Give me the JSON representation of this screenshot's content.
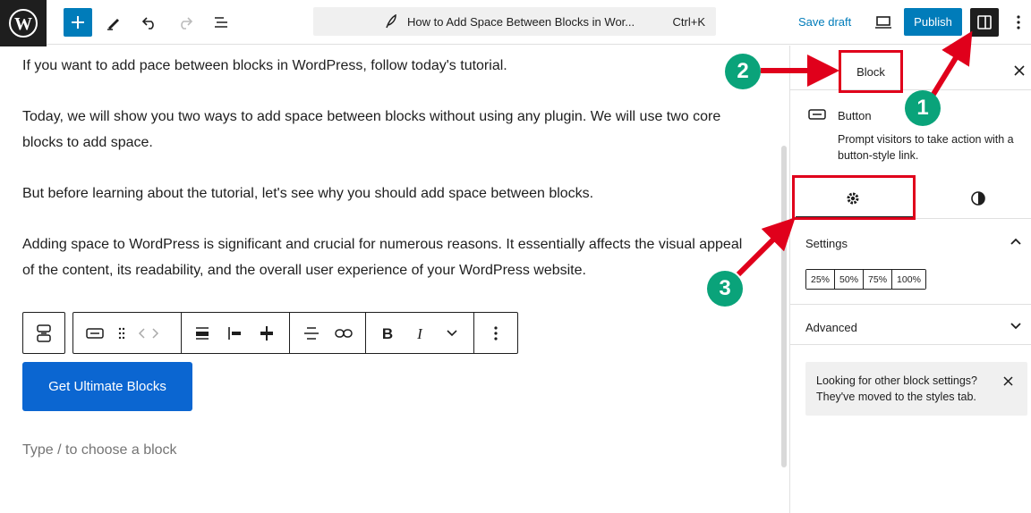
{
  "topbar": {
    "document_title": "How to Add Space Between Blocks in Wor...",
    "shortcut": "Ctrl+K",
    "save_draft": "Save draft",
    "publish": "Publish"
  },
  "content": {
    "paragraphs": [
      "If you want to add pace between blocks in WordPress, follow today's tutorial.",
      "Today, we will show you two ways to add space between blocks without using any plugin. We will use two core blocks to add space.",
      "But before learning about the tutorial, let's see why you should add space between blocks.",
      "Adding space to WordPress is significant and crucial for numerous reasons. It essentially affects the visual appeal of the content, its readability, and the overall user experience of your WordPress website."
    ],
    "button_label": "Get Ultimate Blocks",
    "placeholder": "Type / to choose a block"
  },
  "sidebar": {
    "tab_block": "Block",
    "block_title": "Button",
    "block_description": "Prompt visitors to take action with a button-style link.",
    "settings_title": "Settings",
    "width_options": [
      "25%",
      "50%",
      "75%",
      "100%"
    ],
    "advanced_title": "Advanced",
    "notice_text": "Looking for other block settings? They've moved to the styles tab."
  },
  "annotations": {
    "badges": [
      "1",
      "2",
      "3"
    ],
    "color_highlight": "#e0001b",
    "color_badge": "#0aa37a"
  },
  "colors": {
    "accent": "#007cba",
    "button": "#0b66d1"
  }
}
